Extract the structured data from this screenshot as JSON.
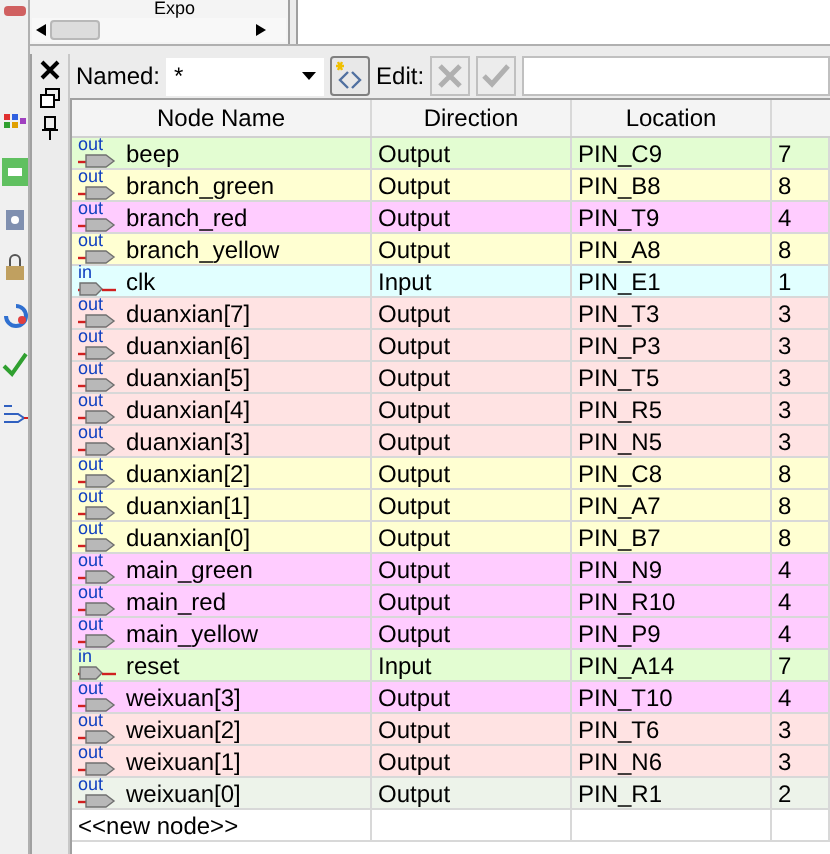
{
  "top_panel": {
    "item": "Expo"
  },
  "filter": {
    "label": "Named:",
    "value": "*",
    "edit_label": "Edit:"
  },
  "table": {
    "columns": [
      "Node Name",
      "Direction",
      "Location"
    ],
    "rows": [
      {
        "kind": "output",
        "pin_label": "out",
        "name": "beep",
        "direction": "Output",
        "location": "PIN_C9",
        "column_4": "7",
        "color": "#e3fdd2"
      },
      {
        "kind": "output",
        "pin_label": "out",
        "name": "branch_green",
        "direction": "Output",
        "location": "PIN_B8",
        "column_4": "8",
        "color": "#ffffd2"
      },
      {
        "kind": "output",
        "pin_label": "out",
        "name": "branch_red",
        "direction": "Output",
        "location": "PIN_T9",
        "column_4": "4",
        "color": "#ffccff"
      },
      {
        "kind": "output",
        "pin_label": "out",
        "name": "branch_yellow",
        "direction": "Output",
        "location": "PIN_A8",
        "column_4": "8",
        "color": "#ffffd2"
      },
      {
        "kind": "input",
        "pin_label": "in",
        "name": "clk",
        "direction": "Input",
        "location": "PIN_E1",
        "column_4": "1",
        "color": "#e1ffff"
      },
      {
        "kind": "output",
        "pin_label": "out",
        "name": "duanxian[7]",
        "direction": "Output",
        "location": "PIN_T3",
        "column_4": "3",
        "color": "#ffe3e3"
      },
      {
        "kind": "output",
        "pin_label": "out",
        "name": "duanxian[6]",
        "direction": "Output",
        "location": "PIN_P3",
        "column_4": "3",
        "color": "#ffe3e3"
      },
      {
        "kind": "output",
        "pin_label": "out",
        "name": "duanxian[5]",
        "direction": "Output",
        "location": "PIN_T5",
        "column_4": "3",
        "color": "#ffe3e3"
      },
      {
        "kind": "output",
        "pin_label": "out",
        "name": "duanxian[4]",
        "direction": "Output",
        "location": "PIN_R5",
        "column_4": "3",
        "color": "#ffe3e3"
      },
      {
        "kind": "output",
        "pin_label": "out",
        "name": "duanxian[3]",
        "direction": "Output",
        "location": "PIN_N5",
        "column_4": "3",
        "color": "#ffe3e3"
      },
      {
        "kind": "output",
        "pin_label": "out",
        "name": "duanxian[2]",
        "direction": "Output",
        "location": "PIN_C8",
        "column_4": "8",
        "color": "#ffffd2"
      },
      {
        "kind": "output",
        "pin_label": "out",
        "name": "duanxian[1]",
        "direction": "Output",
        "location": "PIN_A7",
        "column_4": "8",
        "color": "#ffffd2"
      },
      {
        "kind": "output",
        "pin_label": "out",
        "name": "duanxian[0]",
        "direction": "Output",
        "location": "PIN_B7",
        "column_4": "8",
        "color": "#ffffd2"
      },
      {
        "kind": "output",
        "pin_label": "out",
        "name": "main_green",
        "direction": "Output",
        "location": "PIN_N9",
        "column_4": "4",
        "color": "#ffccff"
      },
      {
        "kind": "output",
        "pin_label": "out",
        "name": "main_red",
        "direction": "Output",
        "location": "PIN_R10",
        "column_4": "4",
        "color": "#ffccff"
      },
      {
        "kind": "output",
        "pin_label": "out",
        "name": "main_yellow",
        "direction": "Output",
        "location": "PIN_P9",
        "column_4": "4",
        "color": "#ffccff"
      },
      {
        "kind": "input",
        "pin_label": "in",
        "name": "reset",
        "direction": "Input",
        "location": "PIN_A14",
        "column_4": "7",
        "color": "#e3fdd2"
      },
      {
        "kind": "output",
        "pin_label": "out",
        "name": "weixuan[3]",
        "direction": "Output",
        "location": "PIN_T10",
        "column_4": "4",
        "color": "#ffccff"
      },
      {
        "kind": "output",
        "pin_label": "out",
        "name": "weixuan[2]",
        "direction": "Output",
        "location": "PIN_T6",
        "column_4": "3",
        "color": "#ffe3e3"
      },
      {
        "kind": "output",
        "pin_label": "out",
        "name": "weixuan[1]",
        "direction": "Output",
        "location": "PIN_N6",
        "column_4": "3",
        "color": "#ffe3e3"
      },
      {
        "kind": "output",
        "pin_label": "out",
        "name": "weixuan[0]",
        "direction": "Output",
        "location": "PIN_R1",
        "column_4": "2",
        "color": "#edf3ea"
      }
    ],
    "new_row": "<<new node>>"
  }
}
